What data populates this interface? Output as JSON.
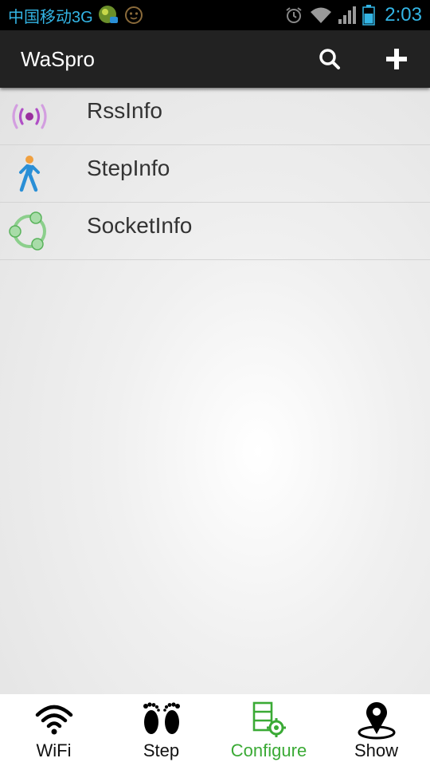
{
  "status_bar": {
    "carrier": "中国移动3G",
    "time": "2:03",
    "icons": [
      "app-notification-icon",
      "face-icon",
      "alarm-icon",
      "wifi-signal-icon",
      "cell-signal-icon",
      "battery-icon"
    ]
  },
  "action_bar": {
    "title": "WaSpro",
    "search_icon": "search-icon",
    "add_icon": "add-icon"
  },
  "list": {
    "items": [
      {
        "label": "RssInfo",
        "icon": "rss-broadcast-icon",
        "icon_color": "#b04fc6"
      },
      {
        "label": "StepInfo",
        "icon": "walking-person-icon",
        "icon_color": "#2a8fd6"
      },
      {
        "label": "SocketInfo",
        "icon": "network-nodes-icon",
        "icon_color": "#59b35b"
      }
    ]
  },
  "bottom_nav": {
    "tabs": [
      {
        "label": "WiFi",
        "icon": "wifi-icon",
        "active": false
      },
      {
        "label": "Step",
        "icon": "footprints-icon",
        "active": false
      },
      {
        "label": "Configure",
        "icon": "configure-icon",
        "active": true
      },
      {
        "label": "Show",
        "icon": "map-pin-icon",
        "active": false
      }
    ],
    "active_color": "#3aaa35"
  },
  "colors": {
    "status_text": "#33b5e5",
    "action_bar_bg": "#222222",
    "status_bar_bg": "#000000"
  }
}
